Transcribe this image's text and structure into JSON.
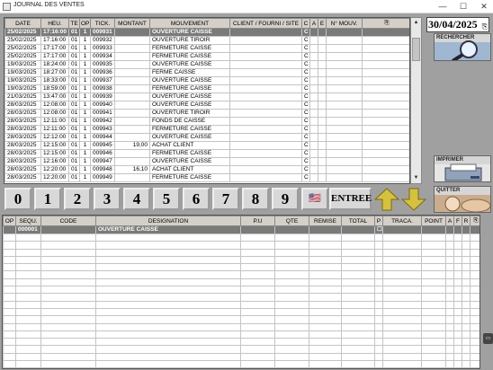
{
  "window": {
    "title": "JOURNAL DES VENTES",
    "minimize": "—",
    "maximize": "☐",
    "close": "✕"
  },
  "top_table": {
    "headers": [
      "DATE",
      "HEU.",
      "TE",
      "OP",
      "TICK.",
      "MONTANT",
      "MOUVEMENT",
      "CLIENT / FOURNI / SITE",
      "C",
      "A",
      "E",
      "N° MOUV.",
      "⎘"
    ],
    "rows": [
      [
        "25/02/2025",
        "17:16:00",
        "01",
        "1",
        "009931",
        "",
        "OUVERTURE CAISSE",
        "",
        "C",
        "",
        "",
        "",
        ""
      ],
      [
        "25/02/2025",
        "17:16:00",
        "01",
        "1",
        "009932",
        "",
        "OUVERTURE TIROIR",
        "",
        "C",
        "",
        "",
        "",
        ""
      ],
      [
        "25/02/2025",
        "17:17:00",
        "01",
        "1",
        "009933",
        "",
        "FERMETURE CAISSE",
        "",
        "C",
        "",
        "",
        "",
        ""
      ],
      [
        "25/02/2025",
        "17:17:00",
        "01",
        "1",
        "009934",
        "",
        "FERMETURE CAISSE",
        "",
        "C",
        "",
        "",
        "",
        ""
      ],
      [
        "19/03/2025",
        "18:24:00",
        "01",
        "1",
        "009935",
        "",
        "OUVERTURE CAISSE",
        "",
        "C",
        "",
        "",
        "",
        ""
      ],
      [
        "19/03/2025",
        "18:27:00",
        "01",
        "1",
        "009936",
        "",
        "FERME CAISSE",
        "",
        "C",
        "",
        "",
        "",
        ""
      ],
      [
        "19/03/2025",
        "18:33:00",
        "01",
        "1",
        "009937",
        "",
        "OUVERTURE CAISSE",
        "",
        "C",
        "",
        "",
        "",
        ""
      ],
      [
        "19/03/2025",
        "18:59:00",
        "01",
        "1",
        "009938",
        "",
        "FERMETURE CAISSE",
        "",
        "C",
        "",
        "",
        "",
        ""
      ],
      [
        "21/03/2025",
        "13:47:00",
        "01",
        "1",
        "009939",
        "",
        "OUVERTURE CAISSE",
        "",
        "C",
        "",
        "",
        "",
        ""
      ],
      [
        "28/03/2025",
        "12:08:00",
        "01",
        "1",
        "009940",
        "",
        "OUVERTURE CAISSE",
        "",
        "C",
        "",
        "",
        "",
        ""
      ],
      [
        "28/03/2025",
        "12:08:00",
        "01",
        "1",
        "009941",
        "",
        "OUVERTURE TIROIR",
        "",
        "C",
        "",
        "",
        "",
        ""
      ],
      [
        "28/03/2025",
        "12:11:00",
        "01",
        "1",
        "009942",
        "",
        "FONDS DE CAISSE",
        "",
        "C",
        "",
        "",
        "",
        ""
      ],
      [
        "28/03/2025",
        "12:11:00",
        "01",
        "1",
        "009943",
        "",
        "FERMETURE CAISSE",
        "",
        "C",
        "",
        "",
        "",
        ""
      ],
      [
        "28/03/2025",
        "12:12:00",
        "01",
        "1",
        "009944",
        "",
        "OUVERTURE CAISSE",
        "",
        "C",
        "",
        "",
        "",
        ""
      ],
      [
        "28/03/2025",
        "12:15:00",
        "01",
        "1",
        "009945",
        "19,00",
        "ACHAT CLIENT",
        "",
        "C",
        "",
        "",
        "",
        ""
      ],
      [
        "28/03/2025",
        "12:15:00",
        "01",
        "1",
        "009946",
        "",
        "FERMETURE CAISSE",
        "",
        "C",
        "",
        "",
        "",
        ""
      ],
      [
        "28/03/2025",
        "12:16:00",
        "01",
        "1",
        "009947",
        "",
        "OUVERTURE CAISSE",
        "",
        "C",
        "",
        "",
        "",
        ""
      ],
      [
        "28/03/2025",
        "12:20:00",
        "01",
        "1",
        "009948",
        "16,10",
        "ACHAT CLIENT",
        "",
        "C",
        "",
        "",
        "",
        ""
      ],
      [
        "28/03/2025",
        "12:20:00",
        "01",
        "1",
        "009949",
        "",
        "FERMETURE CAISSE",
        "",
        "C",
        "",
        "",
        "",
        ""
      ]
    ]
  },
  "right_panel": {
    "date": "30/04/2025",
    "rechercher": "RECHERCHER",
    "imprimer": "IMPRIMER",
    "quitter": "QUITTER"
  },
  "keypad": {
    "digits": [
      "0",
      "1",
      "2",
      "3",
      "4",
      "5",
      "6",
      "7",
      "8",
      "9"
    ],
    "flag": "🇺🇸",
    "entree": "ENTREE"
  },
  "bottom_table": {
    "headers": [
      "OP",
      "SEQU.",
      "CODE",
      "DESIGNATION",
      "P.U",
      "QTE",
      "REMISE",
      "TOTAL",
      "P",
      "TRACA.",
      "POINT",
      "A",
      "F",
      "R",
      "⎘"
    ],
    "rows": [
      [
        "",
        "000001",
        "",
        "OUVERTURE CAISSE",
        "",
        "",
        "",
        "",
        "☐",
        "",
        "",
        "",
        "",
        "",
        ""
      ]
    ]
  },
  "colors": {
    "background": "#a0a0a0",
    "selected_row": "#7a7a7a",
    "header": "#d4d0c8"
  },
  "icons": [
    "app-icon",
    "sort-icon",
    "search-icon",
    "printer-icon",
    "exit-icon",
    "arrow-up-icon",
    "arrow-down-icon",
    "flag-icon",
    "copy-icon"
  ]
}
